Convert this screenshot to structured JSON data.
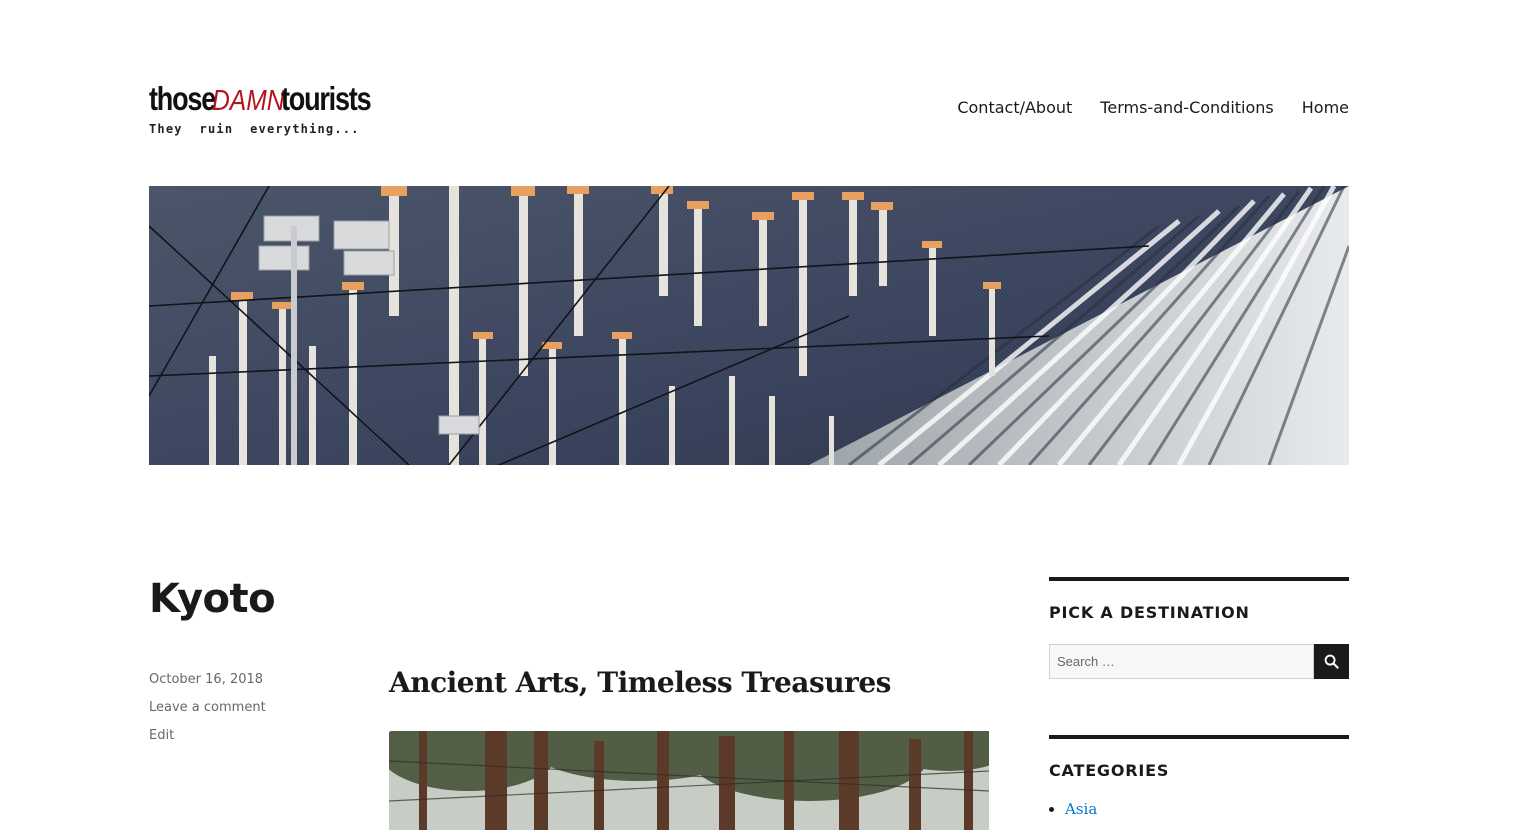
{
  "site": {
    "logo_word_1": "those",
    "logo_word_2": "DAMN",
    "logo_word_3": "tourists",
    "tagline": "They  ruin  everything..."
  },
  "nav": {
    "items": [
      {
        "label": "Contact/About"
      },
      {
        "label": "Terms-and-Conditions"
      },
      {
        "label": "Home"
      }
    ]
  },
  "page": {
    "title": "Kyoto"
  },
  "post": {
    "title": "Ancient Arts, Timeless Treasures",
    "date": "October 16, 2018",
    "comment_link": "Leave a comment",
    "edit_link": "Edit"
  },
  "sidebar": {
    "search_title": "PICK A DESTINATION",
    "search_placeholder": "Search …",
    "search_icon": "search-icon",
    "categories_title": "CATEGORIES",
    "categories": [
      {
        "label": "Asia"
      }
    ]
  },
  "colors": {
    "accent_red": "#b5121b",
    "link_blue": "#007acc",
    "text": "#1a1a1a",
    "meta": "#686868"
  }
}
